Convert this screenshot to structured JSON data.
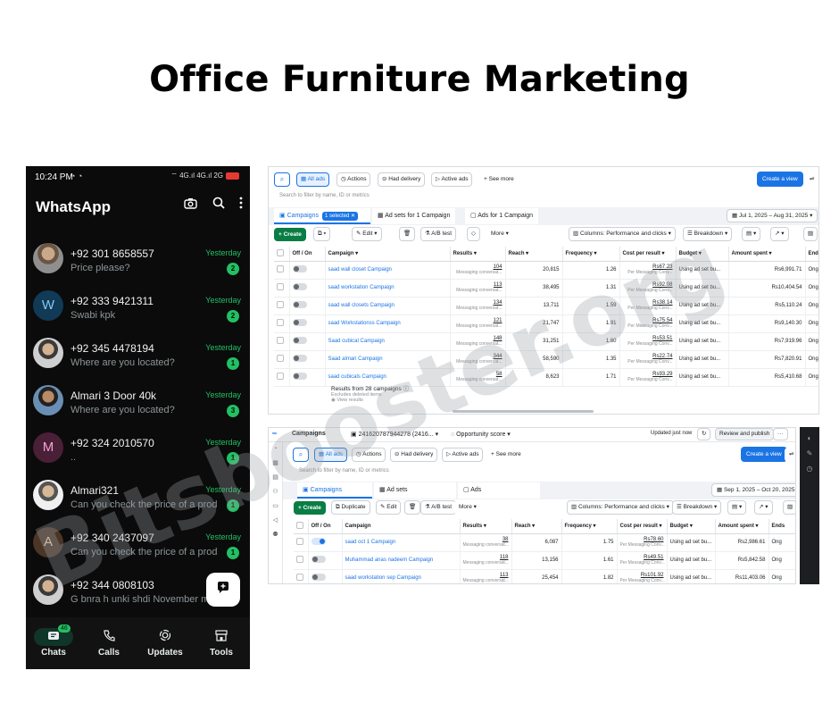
{
  "headline": "Office Furniture Marketing",
  "whatsapp": {
    "status": {
      "time": "10:24 PM",
      "icons": "◔ ◔",
      "right": "⌔ 4G.ıl 4G.ıl 2G"
    },
    "title": "WhatsApp",
    "chats": [
      {
        "name": "+92 301 8658557",
        "msg": "Price please?",
        "when": "Yesterday",
        "badge": "2",
        "avatar": ""
      },
      {
        "name": "+92 333 9421311",
        "msg": "Swabi kpk",
        "when": "Yesterday",
        "badge": "2",
        "avatar": "W"
      },
      {
        "name": "+92 345 4478194",
        "msg": "Where are you located?",
        "when": "Yesterday",
        "badge": "1",
        "avatar": ""
      },
      {
        "name": "Almari 3 Door 40k",
        "msg": "Where are you located?",
        "when": "Yesterday",
        "badge": "3",
        "avatar": ""
      },
      {
        "name": "+92 324 2010570",
        "msg": "..",
        "when": "Yesterday",
        "badge": "1",
        "avatar": "M"
      },
      {
        "name": "Almari321",
        "msg": "Can you check the price of a produ...",
        "when": "Yesterday",
        "badge": "1",
        "avatar": ""
      },
      {
        "name": "+92 340 2437097",
        "msg": "Can you check the price of a produ...",
        "when": "Yesterday",
        "badge": "1",
        "avatar": "A"
      },
      {
        "name": "+92 344 0808103",
        "msg": "G bnra h unki shdi November m h",
        "when": "",
        "badge": "",
        "avatar": ""
      }
    ],
    "nav": [
      {
        "label": "Chats",
        "badge": "46"
      },
      {
        "label": "Calls",
        "badge": ""
      },
      {
        "label": "Updates",
        "badge": ""
      },
      {
        "label": "Tools",
        "badge": ""
      }
    ]
  },
  "ads1": {
    "toolbar": {
      "all_ads": "All ads",
      "actions": "Actions",
      "had_delivery": "Had delivery",
      "active_ads": "Active ads",
      "see_more": "See more",
      "create_view": "Create a view"
    },
    "filter": "Search to filter by name, ID or metrics",
    "tabs": {
      "campaigns": "Campaigns",
      "selected": "1 selected",
      "adsets": "Ad sets for 1 Campaign",
      "ads": "Ads for 1 Campaign"
    },
    "date": "Jul 1, 2025 – Aug 31, 2025",
    "actions": {
      "create": "Create",
      "edit": "Edit",
      "ab": "A/B test",
      "more": "More",
      "columns": "Columns: Performance and clicks",
      "breakdown": "Breakdown"
    },
    "headers": [
      "Off / On",
      "Campaign",
      "Results",
      "Reach",
      "Frequency",
      "Cost per result",
      "Budget",
      "Amount spent",
      "Ends"
    ],
    "rows": [
      {
        "name": "saad wall closet Campaign",
        "results": "104",
        "reach": "20,815",
        "freq": "1.26",
        "cpr": "Rs67.23",
        "budget": "Using ad set bu...",
        "spent": "Rs6,991.71",
        "ends": "Ongo"
      },
      {
        "name": "saad workstation Campaign",
        "results": "113",
        "reach": "38,495",
        "freq": "1.31",
        "cpr": "Rs92.08",
        "budget": "Using ad set bu...",
        "spent": "Rs10,404.54",
        "ends": "Ongo"
      },
      {
        "name": "saad wall closets Campaign",
        "results": "134",
        "reach": "13,711",
        "freq": "1.59",
        "cpr": "Rs38.14",
        "budget": "Using ad set bu...",
        "spent": "Rs5,110.24",
        "ends": "Ongo"
      },
      {
        "name": "saad Workstationss Campaign",
        "results": "121",
        "reach": "21,747",
        "freq": "1.91",
        "cpr": "Rs75.54",
        "budget": "Using ad set bu...",
        "spent": "Rs9,140.30",
        "ends": "Ongo"
      },
      {
        "name": "Saad cubical Campaign",
        "results": "148",
        "reach": "31,251",
        "freq": "1.60",
        "cpr": "Rs53.51",
        "budget": "Using ad set bu...",
        "spent": "Rs7,919.96",
        "ends": "Ongo"
      },
      {
        "name": "Saad almari Campaign",
        "results": "344",
        "reach": "58,590",
        "freq": "1.35",
        "cpr": "Rs22.74",
        "budget": "Using ad set bu...",
        "spent": "Rs7,820.91",
        "ends": "Ongo"
      },
      {
        "name": "saad cubicals Campaign",
        "results": "58",
        "reach": "8,623",
        "freq": "1.71",
        "cpr": "Rs93.29",
        "budget": "Using ad set bu...",
        "spent": "Rs5,410.68",
        "ends": "Ongo"
      }
    ],
    "result_sub": "Messaging conversat...",
    "cpr_sub": "Per Messaging Conv...",
    "footer": {
      "title": "Results from 28 campaigns",
      "excl": "Excludes deleted items",
      "view": "View results"
    }
  },
  "ads2": {
    "topbar": {
      "label": "Campaigns",
      "account": "241620787944278 (2416...",
      "opp": "Opportunity score",
      "updated": "Updated just now",
      "review": "Review and publish"
    },
    "toolbar": {
      "all_ads": "All ads",
      "actions": "Actions",
      "had_delivery": "Had delivery",
      "active_ads": "Active ads",
      "see_more": "See more",
      "create_view": "Create a view"
    },
    "filter": "Search to filter by name, ID or metrics",
    "tabs": {
      "campaigns": "Campaigns",
      "adsets": "Ad sets",
      "ads": "Ads"
    },
    "date": "Sep 1, 2025 – Oct 20, 2025",
    "actions": {
      "create": "Create",
      "duplicate": "Duplicate",
      "edit": "Edit",
      "ab": "A/B test",
      "more": "More",
      "columns": "Columns: Performance and clicks",
      "breakdown": "Breakdown"
    },
    "headers": [
      "Off / On",
      "Campaign",
      "Results",
      "Reach",
      "Frequency",
      "Cost per result",
      "Budget",
      "Amount spent",
      "Ends"
    ],
    "rows": [
      {
        "name": "saad oct 1 Campaign",
        "results": "38",
        "reach": "6,087",
        "freq": "1.75",
        "cpr": "Rs78.60",
        "budget": "Using ad set bu...",
        "spent": "Rs2,986.61",
        "ends": "Ong"
      },
      {
        "name": "Muhammad anas nadeem Campaign",
        "results": "118",
        "reach": "13,156",
        "freq": "1.61",
        "cpr": "Rs49.51",
        "budget": "Using ad set bu...",
        "spent": "Rs5,842.58",
        "ends": "Ong"
      },
      {
        "name": "saad workstation sep Campaign",
        "results": "113",
        "reach": "25,454",
        "freq": "1.82",
        "cpr": "Rs101.92",
        "budget": "Using ad set bu...",
        "spent": "Rs11,403.06",
        "ends": "Ong"
      }
    ],
    "result_sub": "Messaging conversat...",
    "cpr_sub": "Per Messaging Conv..."
  },
  "watermark": "Bitsbooster.org"
}
